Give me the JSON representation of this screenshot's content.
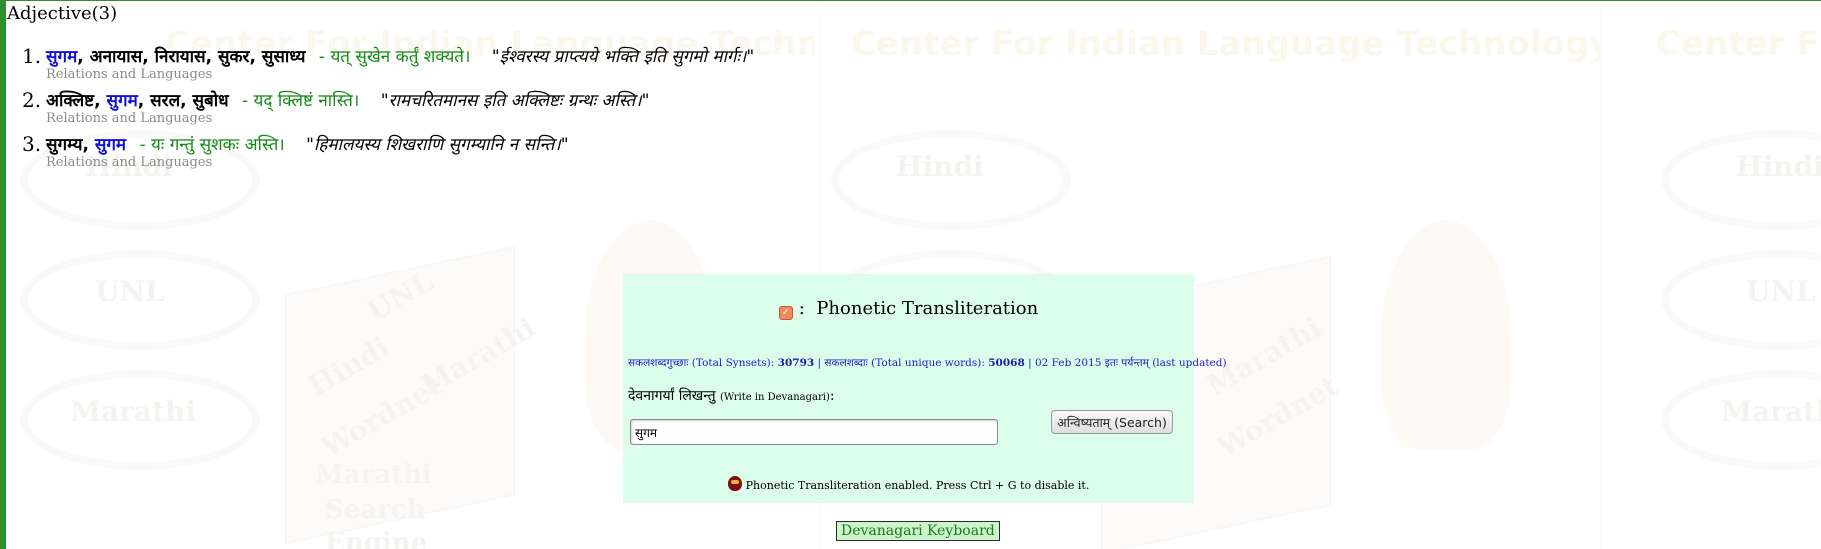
{
  "background": {
    "watermark_title": "Center For Indian Language Technology",
    "watermark_title_short": "Center F",
    "watermark_labels": [
      "Hindi",
      "UNL",
      "Marathi"
    ],
    "watermark_cube_words": [
      "UNL",
      "Hindi",
      "Wordnet",
      "Marathi",
      "Wordnet"
    ],
    "watermark_engine_text": [
      "Marathi",
      "Search",
      "Engine"
    ]
  },
  "results": {
    "heading": "Adjective(3)",
    "items": [
      {
        "number": "1.",
        "words": [
          {
            "text": "सुगम",
            "highlight": true
          },
          {
            "text": "अनायास",
            "highlight": false
          },
          {
            "text": "निरायास",
            "highlight": false
          },
          {
            "text": "सुकर",
            "highlight": false
          },
          {
            "text": "सुसाध्य",
            "highlight": false
          }
        ],
        "gloss": "- यत् सुखेन कर्तुं शक्यते।",
        "example": "\"ईश्वरस्य प्राप्त्यये भक्ति इति सुगमो मार्गः।\"",
        "link": "Relations and Languages"
      },
      {
        "number": "2.",
        "words": [
          {
            "text": "अक्लिष्ट",
            "highlight": false
          },
          {
            "text": "सुगम",
            "highlight": true
          },
          {
            "text": "सरल",
            "highlight": false
          },
          {
            "text": "सुबोध",
            "highlight": false
          }
        ],
        "gloss": "- यद् क्लिष्टं नास्ति।",
        "example": "\"रामचरितमानस इति अक्लिष्टः ग्रन्थः अस्ति।\"",
        "link": "Relations and Languages"
      },
      {
        "number": "3.",
        "words": [
          {
            "text": "सुगम्य",
            "highlight": false
          },
          {
            "text": "सुगम",
            "highlight": true
          }
        ],
        "gloss": "- यः गन्तुं सुशकः अस्ति।",
        "example": "\"हिमालयस्य शिखराणि सुगम्यानि न सन्ति।\"",
        "link": "Relations and Languages"
      }
    ]
  },
  "panel": {
    "toggle_icon": "checkbox-icon",
    "title_sep": ":",
    "title": "Phonetic Transliteration",
    "stats_synsets_label": "सकलशब्दगुच्छाः (Total Synsets):",
    "stats_synsets_value": "30793",
    "stats_words_label": "| सकलशब्दाः (Total unique words):",
    "stats_words_value": "50068",
    "stats_updated": "| 02 Feb 2015 इतः पर्यन्तम् (last updated)",
    "write_label": "देवनागर्यां लिखन्तु",
    "write_label_en": "(Write in Devanagari)",
    "write_label_colon": ":",
    "search_value": "सुगम",
    "search_button": "अन्विष्यताम् (Search)",
    "notice_icon": "keyboard-mascot-icon",
    "notice": "Phonetic Transliteration enabled. Press Ctrl + G to disable it."
  },
  "keyboard_button": "Devanagari Keyboard",
  "colors": {
    "frame": "#2f8f2f",
    "panel_bg": "#dcfde9",
    "highlight_word": "#1010d8",
    "gloss": "#138a13",
    "stats": "#2020cc"
  }
}
